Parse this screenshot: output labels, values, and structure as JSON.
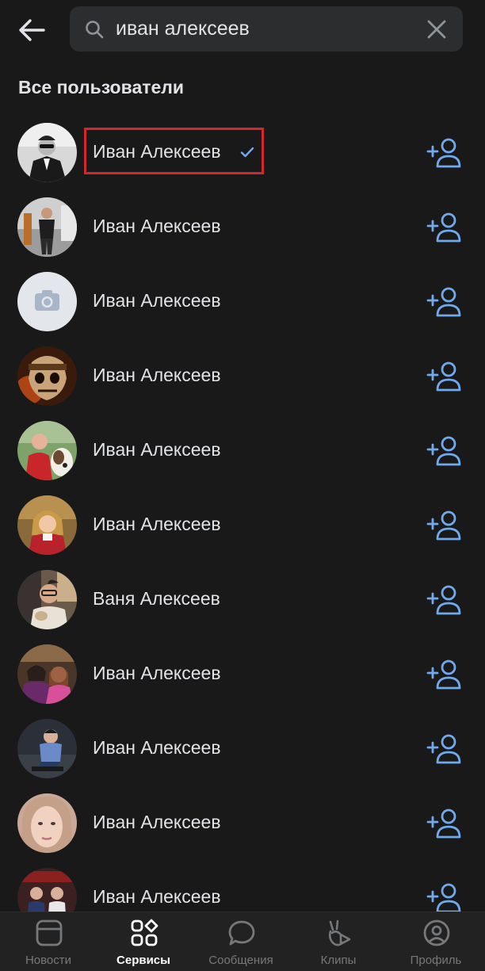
{
  "search": {
    "value": "иван алексеев"
  },
  "section_title": "Все пользователи",
  "users": [
    {
      "name": "Иван Алексеев",
      "verified": true,
      "avatar": "avatar-man-suit-bw"
    },
    {
      "name": "Иван Алексеев",
      "verified": false,
      "avatar": "avatar-man-standing"
    },
    {
      "name": "Иван Алексеев",
      "verified": false,
      "avatar": "avatar-placeholder-camera"
    },
    {
      "name": "Иван Алексеев",
      "verified": false,
      "avatar": "avatar-skull"
    },
    {
      "name": "Иван Алексеев",
      "verified": false,
      "avatar": "avatar-man-with-dog"
    },
    {
      "name": "Иван Алексеев",
      "verified": false,
      "avatar": "avatar-child"
    },
    {
      "name": "Ваня Алексеев",
      "verified": false,
      "avatar": "avatar-man-glasses"
    },
    {
      "name": "Иван Алексеев",
      "verified": false,
      "avatar": "avatar-two-girls"
    },
    {
      "name": "Иван Алексеев",
      "verified": false,
      "avatar": "avatar-man-sitting"
    },
    {
      "name": "Иван Алексеев",
      "verified": false,
      "avatar": "avatar-girl-face"
    },
    {
      "name": "Иван Алексеев",
      "verified": false,
      "avatar": "avatar-two-men"
    }
  ],
  "nav": {
    "items": [
      {
        "label": "Новости",
        "icon": "news-icon",
        "active": false
      },
      {
        "label": "Сервисы",
        "icon": "services-icon",
        "active": true
      },
      {
        "label": "Сообщения",
        "icon": "messages-icon",
        "active": false
      },
      {
        "label": "Клипы",
        "icon": "clips-icon",
        "active": false
      },
      {
        "label": "Профиль",
        "icon": "profile-icon",
        "active": false
      }
    ]
  },
  "colors": {
    "background": "#19191a",
    "accent": "#71aaeb",
    "highlight": "#d5262f",
    "text": "#e1e3e6",
    "nav_inactive": "#76787a"
  }
}
